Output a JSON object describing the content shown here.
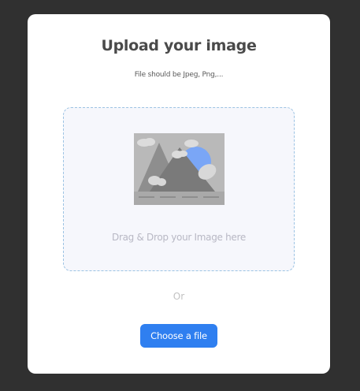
{
  "upload": {
    "title": "Upload your image",
    "subtitle": "File should be Jpeg, Png,...",
    "drop_text": "Drag & Drop your Image here",
    "or_text": "Or",
    "choose_button_label": "Choose a file"
  },
  "icons": {
    "illustration": "image-placeholder-icon"
  },
  "colors": {
    "background": "#303030",
    "card": "#ffffff",
    "accent": "#2f7ff0",
    "dropzone_bg": "#f6f7fc",
    "dropzone_border": "#9cc3e3"
  }
}
